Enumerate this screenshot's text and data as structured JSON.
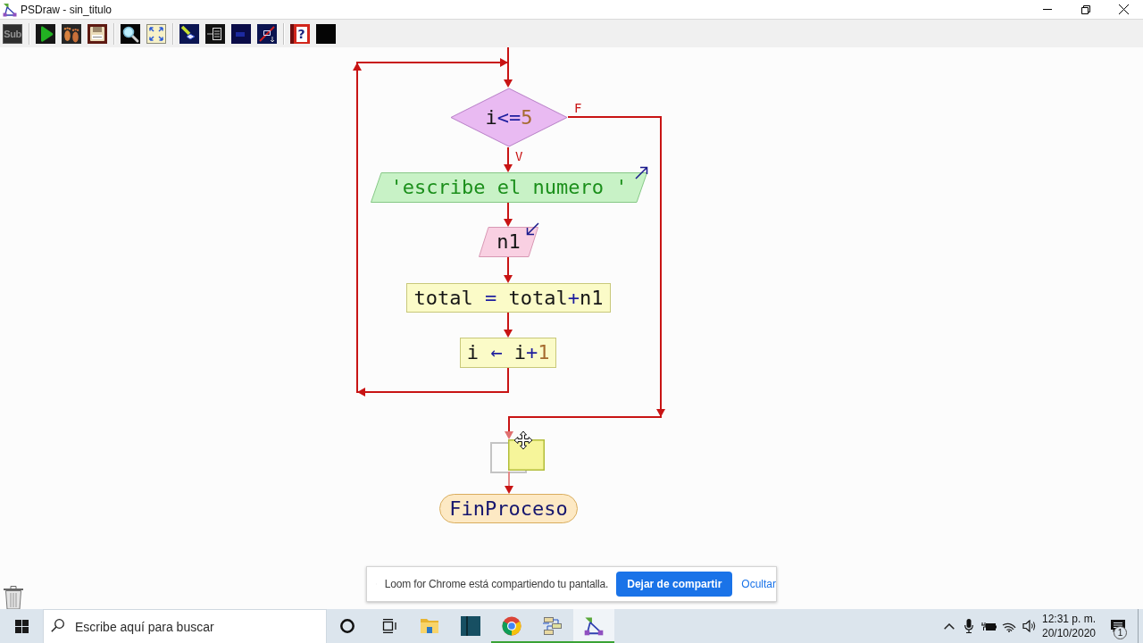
{
  "window": {
    "title": "PSDraw - sin_titulo"
  },
  "toolbar": {
    "sub_label": "Sub",
    "help_glyph": "?"
  },
  "flowchart": {
    "nodes": [
      {
        "kind": "decision",
        "text": "i<=5",
        "true_label": "V",
        "false_label": "F",
        "dragging": false
      },
      {
        "kind": "output",
        "text": "'escribe el numero '",
        "dragging": false
      },
      {
        "kind": "input",
        "text": "n1",
        "dragging": false
      },
      {
        "kind": "process",
        "text": "total = total+n1",
        "dragging": false
      },
      {
        "kind": "process",
        "text": "i ← i+1",
        "dragging": false
      },
      {
        "kind": "process",
        "dragging": true
      },
      {
        "kind": "end",
        "text": "FinProceso",
        "dragging": false
      }
    ]
  },
  "share_bar": {
    "message": "Loom for Chrome está compartiendo tu pantalla.",
    "stop_button": "Dejar de compartir",
    "hide_link": "Ocultar"
  },
  "taskbar": {
    "search": {
      "placeholder": "Escribe aquí para buscar"
    },
    "apps": [
      {
        "kind": "folder",
        "running": false,
        "selected": false
      },
      {
        "kind": "tile",
        "running": false,
        "selected": false
      },
      {
        "kind": "browser",
        "running": true,
        "selected": false
      },
      {
        "kind": "tool",
        "running": true,
        "selected": false
      },
      {
        "kind": "flowchart",
        "running": true,
        "selected": true
      }
    ],
    "clock": {
      "time": "12:31 p. m.",
      "date": "20/10/2020"
    },
    "notifications": {
      "count": "1"
    }
  }
}
